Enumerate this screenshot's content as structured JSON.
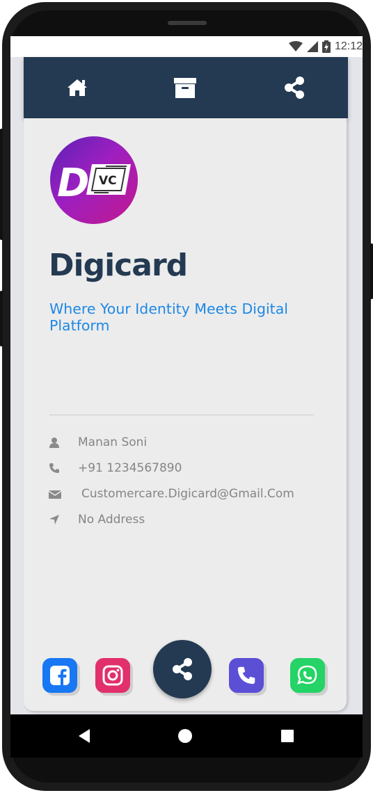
{
  "status_bar": {
    "time": "12:12"
  },
  "nav": {
    "home_icon": "home-icon",
    "archive_icon": "archive-icon",
    "share_icon": "share-icon"
  },
  "logo": {
    "letter": "D",
    "badge_text": "VC"
  },
  "profile": {
    "title": "Digicard",
    "tagline": "Where Your Identity Meets Digital Platform"
  },
  "contact": {
    "name": "Manan Soni",
    "phone": "+91 1234567890",
    "email": "Customercare.Digicard@Gmail.Com",
    "address": "No Address"
  },
  "social": {
    "facebook_color": "#1877f2",
    "instagram_color": "#e1306c",
    "phone_color": "#5b4fd6",
    "whatsapp_color": "#25d366"
  },
  "colors": {
    "primary": "#243a52",
    "accent": "#1e88e5",
    "muted_text": "#858585"
  }
}
